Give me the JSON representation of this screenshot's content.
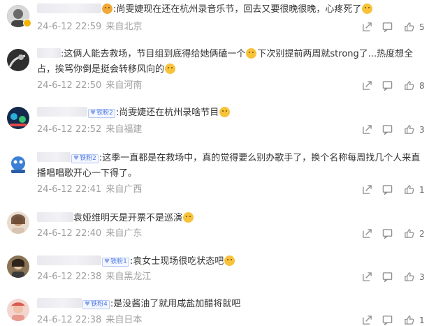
{
  "comments": [
    {
      "text": ":尚雯婕现在还在杭州录音乐节，回去又要很晚很晚，心疼死了",
      "fan_label": "",
      "date": "24-6-12 22:59",
      "location": "来自北京",
      "likes": "5",
      "avatar_color": "#5a5a5a",
      "emoji": "sad"
    },
    {
      "text": ":这俩人能去救场，节目组到底得给她俩磕一个",
      "text2": "下次别提前两周就strong了...热度想全占，挨骂你倒是挺会转移风向的",
      "fan_label": "",
      "date": "24-6-12 22:50",
      "location": "来自河南",
      "likes": "8",
      "avatar_color": "#3d3d3d"
    },
    {
      "text": ":尚雯婕还在杭州录啥节目",
      "fan_label": "铁粉2",
      "date": "24-6-12 22:52",
      "location": "来自福建",
      "likes": "3",
      "avatar_color": "#1b3a6b"
    },
    {
      "text": ":这季一直都是在救场中，真的觉得要么别办歌手了，换个名称每周找几个人来直播唱唱歌开心一下得了。",
      "fan_label": "铁粉2",
      "date": "24-6-12 22:41",
      "location": "来自广西",
      "likes": "1",
      "avatar_color": "#3b7fd6"
    },
    {
      "text": "袁娅维明天是开票不是巡演",
      "fan_label": "",
      "date": "24-6-12 22:40",
      "location": "来自广东",
      "likes": "2",
      "avatar_color": "#c9a98d"
    },
    {
      "text": ":袁女士现场很吃状态吧",
      "fan_label": "铁粉1",
      "date": "24-6-12 22:38",
      "location": "来自黑龙江",
      "likes": "3",
      "avatar_color": "#6e5a3c"
    },
    {
      "text": ":是没酱油了就用咸盐加醋将就吧",
      "fan_label": "铁粉4",
      "date": "24-6-12 22:38",
      "location": "来自日本",
      "likes": "1",
      "avatar_color": "#d88b87"
    }
  ],
  "icons": {
    "share": "share-icon",
    "comment": "comment-icon",
    "like": "thumbs-up-icon"
  }
}
